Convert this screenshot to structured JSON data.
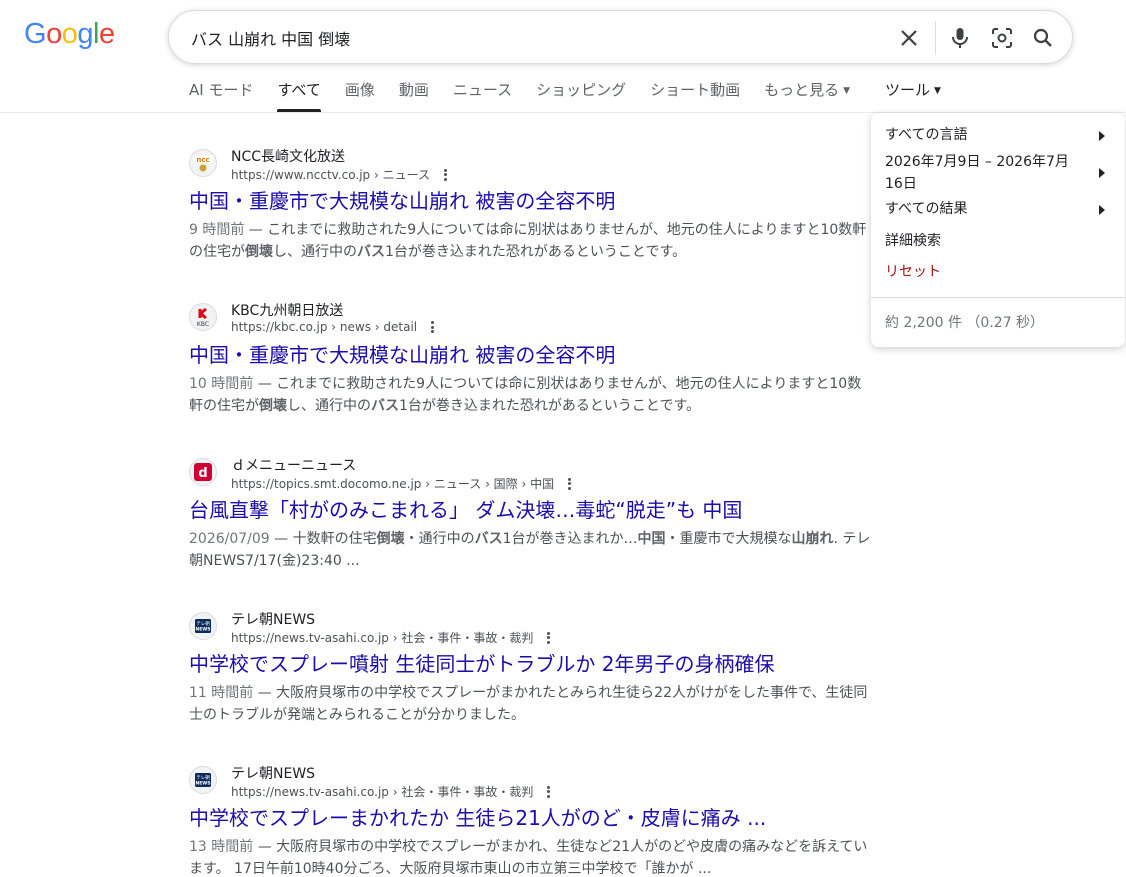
{
  "search": {
    "query": "バス 山崩れ 中国 倒壊"
  },
  "logo": {
    "letters": [
      "G",
      "o",
      "o",
      "g",
      "l",
      "e"
    ],
    "colors": [
      "#4285F4",
      "#EA4335",
      "#FBBC05",
      "#4285F4",
      "#34A853",
      "#EA4335"
    ]
  },
  "tabs": [
    {
      "label": "AI モード",
      "active": false
    },
    {
      "label": "すべて",
      "active": true
    },
    {
      "label": "画像",
      "active": false
    },
    {
      "label": "動画",
      "active": false
    },
    {
      "label": "ニュース",
      "active": false
    },
    {
      "label": "ショッピング",
      "active": false
    },
    {
      "label": "ショート動画",
      "active": false
    },
    {
      "label": "もっと見る",
      "active": false
    }
  ],
  "tools_label": "ツール",
  "tools_menu": {
    "language": "すべての言語",
    "date_range_line1": "2026年7月9日 – 2026年7月",
    "date_range_line2": "16日",
    "results_filter": "すべての結果",
    "advanced": "詳細検索",
    "reset": "リセット",
    "stats": "約 2,200 件 （0.27 秒）"
  },
  "colors": {
    "link": "#1a0dab",
    "reset": "#a50e0e"
  },
  "results": [
    {
      "site": "NCC長崎文化放送",
      "url": "https://www.ncctv.co.jp › ニュース",
      "favicon": "ncc-icon",
      "title": "中国・重慶市で大規模な山崩れ 被害の全容不明",
      "date": "9 時間前",
      "snippet_parts": [
        "これまでに救助された9人については命に別状はありませんが、地元の住人によりますと10数軒の住宅が",
        "倒壊",
        "し、通行中の",
        "バス",
        "1台が巻き込まれた恐れがあるということです。"
      ]
    },
    {
      "site": "KBC九州朝日放送",
      "url": "https://kbc.co.jp › news › detail",
      "favicon": "kbc-icon",
      "title": "中国・重慶市で大規模な山崩れ 被害の全容不明",
      "date": "10 時間前",
      "snippet_parts": [
        "これまでに救助された9人については命に別状はありませんが、地元の住人によりますと10数軒の住宅が",
        "倒壊",
        "し、通行中の",
        "バス",
        "1台が巻き込まれた恐れがあるということです。"
      ]
    },
    {
      "site": "ｄメニューニュース",
      "url": "https://topics.smt.docomo.ne.jp › ニュース › 国際 › 中国",
      "favicon": "dmenu-icon",
      "title": "台風直撃「村がのみこまれる」 ダム決壊…毒蛇“脱走”も 中国",
      "date": "2026/07/09",
      "snippet_parts": [
        "十数軒の住宅",
        "倒壊",
        "・通行中の",
        "バス",
        "1台が巻き込まれか…",
        "中国",
        "・重慶市で大規模な",
        "山崩れ",
        ". テレ朝NEWS7/17(金)23:40 ..."
      ]
    },
    {
      "site": "テレ朝NEWS",
      "url": "https://news.tv-asahi.co.jp › 社会・事件・事故・裁判",
      "favicon": "tvasahi-icon",
      "title": "中学校でスプレー噴射 生徒同士がトラブルか 2年男子の身柄確保",
      "date": "11 時間前",
      "snippet_parts": [
        "大阪府貝塚市の中学校でスプレーがまかれたとみられ生徒ら22人がけがをした事件で、生徒同士のトラブルが発端とみられることが分かりました。"
      ]
    },
    {
      "site": "テレ朝NEWS",
      "url": "https://news.tv-asahi.co.jp › 社会・事件・事故・裁判",
      "favicon": "tvasahi-icon",
      "title": "中学校でスプレーまかれたか 生徒ら21人がのど・皮膚に痛み ...",
      "date": "13 時間前",
      "snippet_parts": [
        "大阪府貝塚市の中学校でスプレーがまかれ、生徒など21人がのどや皮膚の痛みなどを訴えています。 17日午前10時40分ごろ、大阪府貝塚市東山の市立第三中学校で「誰かが ..."
      ]
    }
  ]
}
